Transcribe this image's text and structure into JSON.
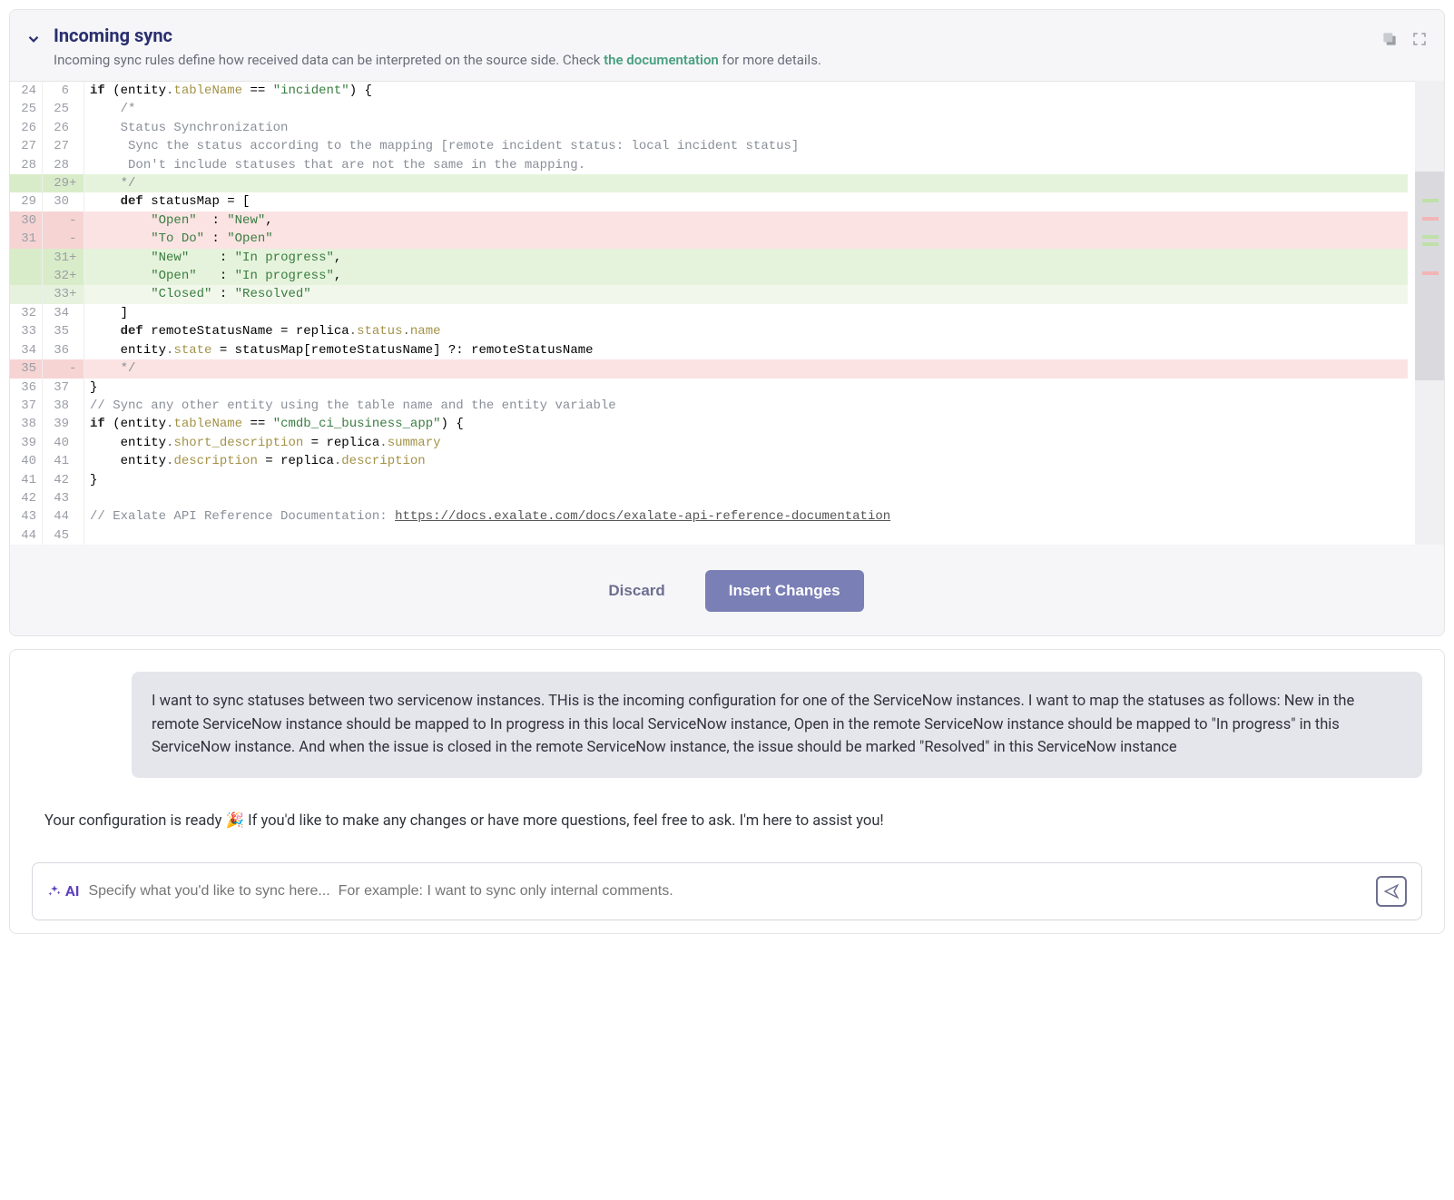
{
  "header": {
    "title": "Incoming sync",
    "subtitle_prefix": "Incoming sync rules define how received data can be interpreted on the source side. Check ",
    "subtitle_link": "the documentation",
    "subtitle_suffix": " for more details."
  },
  "diff": {
    "rows": [
      {
        "l": "24",
        "r": "6",
        "kind": "",
        "tokens": [
          [
            "c-if",
            "if"
          ],
          [
            "",
            " ("
          ],
          [
            "",
            "entity"
          ],
          [
            "c-op",
            "."
          ],
          [
            "c-prop",
            "tableName"
          ],
          [
            "",
            " == "
          ],
          [
            "c-str",
            "\"incident\""
          ],
          [
            "",
            ") {"
          ]
        ]
      },
      {
        "l": "25",
        "r": "25",
        "kind": "",
        "indent": 1,
        "tokens": [
          [
            "c-cmt",
            "/*"
          ]
        ]
      },
      {
        "l": "26",
        "r": "26",
        "kind": "",
        "indent": 1,
        "tokens": [
          [
            "c-cmt",
            "Status Synchronization"
          ]
        ]
      },
      {
        "l": "27",
        "r": "27",
        "kind": "",
        "indent": 1,
        "tokens": [
          [
            "c-cmt",
            " Sync the status according to the mapping [remote incident status: local incident status]"
          ]
        ]
      },
      {
        "l": "28",
        "r": "28",
        "kind": "",
        "indent": 1,
        "tokens": [
          [
            "c-cmt",
            " Don't include statuses that are not the same in the mapping."
          ]
        ]
      },
      {
        "l": "",
        "r": "29",
        "sigR": "+",
        "kind": "added",
        "indent": 1,
        "tokens": [
          [
            "c-cmt",
            "*/"
          ]
        ]
      },
      {
        "l": "29",
        "r": "30",
        "kind": "",
        "indent": 1,
        "tokens": [
          [
            "c-kw",
            "def"
          ],
          [
            "",
            " statusMap = ["
          ]
        ]
      },
      {
        "l": "30",
        "r": "",
        "sigR": "-",
        "kind": "removed",
        "indent": 2,
        "tokens": [
          [
            "c-str",
            "\"Open\""
          ],
          [
            "",
            "  : "
          ],
          [
            "c-str",
            "\"New\""
          ],
          [
            "",
            ","
          ]
        ]
      },
      {
        "l": "31",
        "r": "",
        "sigR": "-",
        "kind": "removed",
        "indent": 2,
        "tokens": [
          [
            "c-str",
            "\"To Do\""
          ],
          [
            "",
            " : "
          ],
          [
            "c-str",
            "\"Open\""
          ]
        ]
      },
      {
        "l": "",
        "r": "31",
        "sigR": "+",
        "kind": "added",
        "indent": 2,
        "tokens": [
          [
            "c-str",
            "\"New\""
          ],
          [
            "",
            "    : "
          ],
          [
            "c-str",
            "\"In progress\""
          ],
          [
            "",
            ","
          ]
        ]
      },
      {
        "l": "",
        "r": "32",
        "sigR": "+",
        "kind": "added",
        "indent": 2,
        "tokens": [
          [
            "c-str",
            "\"Open\""
          ],
          [
            "",
            "   : "
          ],
          [
            "c-str",
            "\"In progress\""
          ],
          [
            "",
            ","
          ]
        ]
      },
      {
        "l": "",
        "r": "33",
        "sigR": "+",
        "kind": "added-lite",
        "indent": 2,
        "tokens": [
          [
            "c-str",
            "\"Closed\""
          ],
          [
            "",
            " : "
          ],
          [
            "c-str",
            "\"Resolved\""
          ]
        ]
      },
      {
        "l": "32",
        "r": "34",
        "kind": "",
        "indent": 1,
        "tokens": [
          [
            "",
            "]"
          ]
        ]
      },
      {
        "l": "33",
        "r": "35",
        "kind": "",
        "indent": 1,
        "tokens": [
          [
            "c-kw",
            "def"
          ],
          [
            "",
            " remoteStatusName = replica"
          ],
          [
            "c-op",
            "."
          ],
          [
            "c-prop",
            "status"
          ],
          [
            "c-op",
            "."
          ],
          [
            "c-prop",
            "name"
          ]
        ]
      },
      {
        "l": "34",
        "r": "36",
        "kind": "",
        "indent": 1,
        "tokens": [
          [
            "",
            "entity"
          ],
          [
            "c-op",
            "."
          ],
          [
            "c-prop",
            "state"
          ],
          [
            "",
            " = statusMap[remoteStatusName] ?: remoteStatusName"
          ]
        ]
      },
      {
        "l": "35",
        "r": "",
        "sigR": "-",
        "kind": "removed",
        "indent": 1,
        "tokens": [
          [
            "c-cmt",
            "*/"
          ]
        ]
      },
      {
        "l": "36",
        "r": "37",
        "kind": "",
        "tokens": [
          [
            "",
            "}"
          ]
        ]
      },
      {
        "l": "37",
        "r": "38",
        "kind": "",
        "tokens": [
          [
            "c-cmt",
            "// Sync any other entity using the table name and the entity variable"
          ]
        ]
      },
      {
        "l": "38",
        "r": "39",
        "kind": "",
        "tokens": [
          [
            "c-if",
            "if"
          ],
          [
            "",
            " ("
          ],
          [
            "",
            "entity"
          ],
          [
            "c-op",
            "."
          ],
          [
            "c-prop",
            "tableName"
          ],
          [
            "",
            " == "
          ],
          [
            "c-str",
            "\"cmdb_ci_business_app\""
          ],
          [
            "",
            ") {"
          ]
        ]
      },
      {
        "l": "39",
        "r": "40",
        "kind": "",
        "indent": 1,
        "tokens": [
          [
            "",
            "entity"
          ],
          [
            "c-op",
            "."
          ],
          [
            "c-prop",
            "short_description"
          ],
          [
            "",
            " = replica"
          ],
          [
            "c-op",
            "."
          ],
          [
            "c-prop",
            "summary"
          ]
        ]
      },
      {
        "l": "40",
        "r": "41",
        "kind": "",
        "indent": 1,
        "tokens": [
          [
            "",
            "entity"
          ],
          [
            "c-op",
            "."
          ],
          [
            "c-prop",
            "description"
          ],
          [
            "",
            " = replica"
          ],
          [
            "c-op",
            "."
          ],
          [
            "c-prop",
            "description"
          ]
        ]
      },
      {
        "l": "41",
        "r": "42",
        "kind": "",
        "tokens": [
          [
            "",
            "}"
          ]
        ]
      },
      {
        "l": "42",
        "r": "43",
        "kind": "",
        "tokens": [
          [
            "",
            ""
          ]
        ]
      },
      {
        "l": "43",
        "r": "44",
        "kind": "",
        "tokens": [
          [
            "c-cmt",
            "// Exalate API Reference Documentation: "
          ],
          [
            "c-url",
            "https://docs.exalate.com/docs/exalate-api-reference-documentation"
          ]
        ]
      },
      {
        "l": "44",
        "r": "45",
        "kind": "",
        "tokens": [
          [
            "",
            ""
          ]
        ]
      }
    ]
  },
  "actions": {
    "discard": "Discard",
    "insert": "Insert Changes"
  },
  "chat": {
    "user_message": "I want to sync statuses between two servicenow instances. THis is the incoming configuration for one of the ServiceNow instances. I want to map the statuses as follows: New in the remote ServiceNow instance should be mapped to In progress in this local ServiceNow instance, Open in the remote ServiceNow instance should be mapped to \"In progress\" in this ServiceNow instance. And when the issue is closed in the remote ServiceNow instance, the issue should be marked \"Resolved\" in this ServiceNow instance",
    "assistant_prefix": "Your configuration is ready",
    "assistant_suffix": "If you'd like to make any changes or have more questions, feel free to ask. I'm here to assist you!",
    "ai_label": "AI",
    "placeholder": "Specify what you'd like to sync here...  For example: I want to sync only internal comments."
  }
}
